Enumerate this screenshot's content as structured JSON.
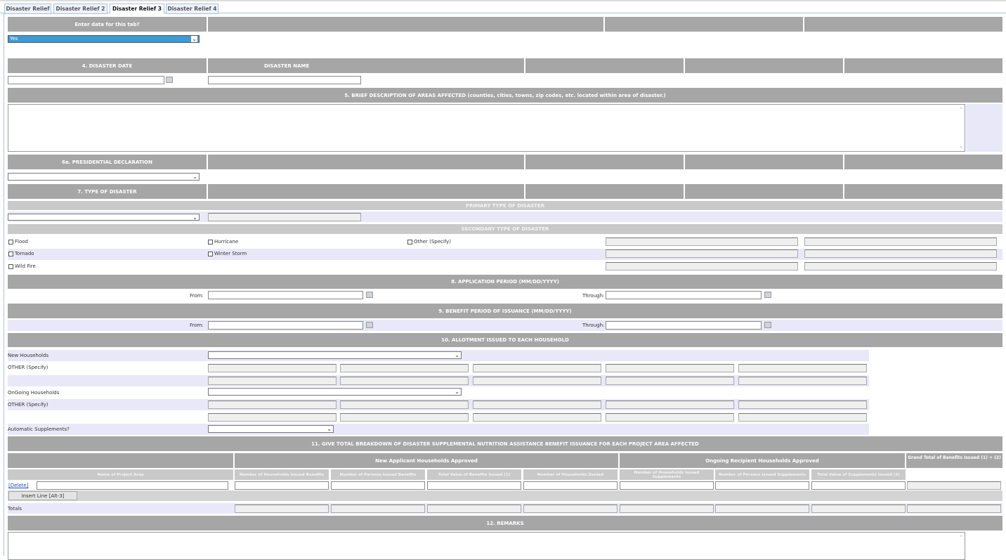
{
  "tabs": [
    {
      "label": "Disaster Relief"
    },
    {
      "label": "Disaster Relief 2"
    },
    {
      "label": "Disaster Relief 3",
      "active": true
    },
    {
      "label": "Disaster Relief 4"
    }
  ],
  "enter_data": {
    "header": "Enter data for this tab?",
    "value": "Yes"
  },
  "disaster": {
    "date_header": "4. DISASTER DATE",
    "name_header": "DISASTER NAME",
    "date_value": "",
    "name_value": ""
  },
  "areas": {
    "header": "5. BRIEF DESCRIPTION OF AREAS AFFECTED (counties, cities, towns, zip codes, etc. located within area of disaster.)",
    "value": ""
  },
  "presidential": {
    "header": "6a. PRESIDENTIAL DECLARATION",
    "value": ""
  },
  "type": {
    "header": "7. TYPE OF DISASTER",
    "primary_header": "PRIMARY TYPE OF DISASTER",
    "secondary_header": "SECONDARY TYPE OF DISASTER",
    "checkboxes": [
      {
        "label": "Flood",
        "checked": false
      },
      {
        "label": "Hurricane",
        "checked": false
      },
      {
        "label": "Other (Specify)",
        "checked": false
      },
      {
        "label": "Tornado",
        "checked": false
      },
      {
        "label": "Winter Storm",
        "checked": false
      },
      {
        "label": "Wild Fire",
        "checked": false
      }
    ]
  },
  "application_period": {
    "header": "8. APPLICATION PERIOD (MM/DD/YYYY)",
    "from_label": "From:",
    "through_label": "Through:"
  },
  "benefit_period": {
    "header": "9. BENEFIT PERIOD OF ISSUANCE (MM/DD/YYYY)",
    "from_label": "From:",
    "through_label": "Through:"
  },
  "allotment": {
    "header": "10. ALLOTMENT ISSUED TO EACH HOUSEHOLD",
    "new_households": "New Households",
    "other1": "OTHER (Specify)",
    "ongoing_households": "OnGoing Households",
    "other2": "OTHER (Specify)",
    "automatic": "Automatic Supplements?"
  },
  "breakdown": {
    "header": "11. GIVE TOTAL BREAKDOWN OF DISASTER SUPPLEMENTAL NUTRITION ASSISTANCE BENEFIT ISSUANCE FOR EACH PROJECT AREA AFFECTED",
    "group_new": "New Applicant Households Approved",
    "group_ongoing": "Ongoing Recipient Households Approved",
    "grand_total": "Grand Total of Benefits Issued (1) + (2)",
    "columns": [
      "Name of Project Area",
      "Number of Households Issued Benefits",
      "Number of Persons Issued Benefits",
      "Total Value of Benefits Issued (1)",
      "Number of Households Denied",
      "Number of Households Issued Supplements",
      "Number of Persons Issued Supplements",
      "Total Value of Supplements Issued (2)"
    ],
    "delete_link": "[Delete]",
    "insert_button": "Insert Line [Alt-3]",
    "totals_label": "Totals"
  },
  "remarks": {
    "header": "12. REMARKS",
    "value": ""
  },
  "colors": {
    "header": "#a6a6a6",
    "subheader": "#c9c9c9",
    "alt_row": "#e8e8f8",
    "selected": "#3e9ad6",
    "tab_border": "#a9c3e6"
  }
}
